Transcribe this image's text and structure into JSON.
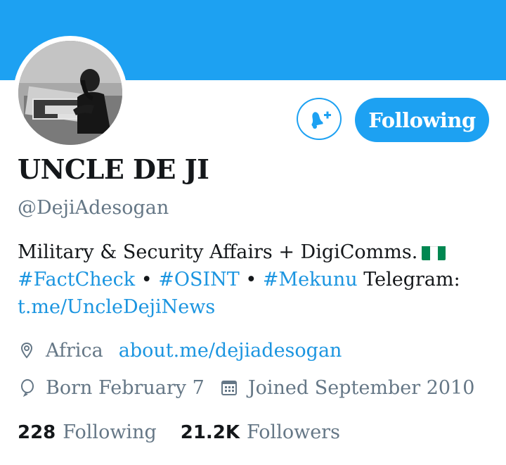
{
  "profile": {
    "display_name": "UNCLE DE JI",
    "handle": "@DejiAdesogan",
    "follow_button_label": "Following",
    "avatar_icon": "profile-photo"
  },
  "bio": {
    "text1": "Military & Security Affairs + DigiComms.",
    "hashtag1": "#FactCheck",
    "sep1": " • ",
    "hashtag2": "#OSINT",
    "sep2": " • ",
    "hashtag3": "#Mekunu",
    "telegram_label": " Telegram: ",
    "telegram_link": "t.me/UncleDejiNews",
    "flag_colors": [
      "#008751",
      "#ffffff",
      "#008751"
    ]
  },
  "meta": {
    "location": "Africa",
    "website": "about.me/dejiadesogan",
    "birthday": "Born February 7",
    "joined": "Joined September 2010"
  },
  "stats": {
    "following_count": "228",
    "following_label": "Following",
    "followers_count": "21.2K",
    "followers_label": "Followers"
  },
  "colors": {
    "accent": "#1da1f2",
    "link": "#1b95e0",
    "secondary_text": "#657786"
  }
}
